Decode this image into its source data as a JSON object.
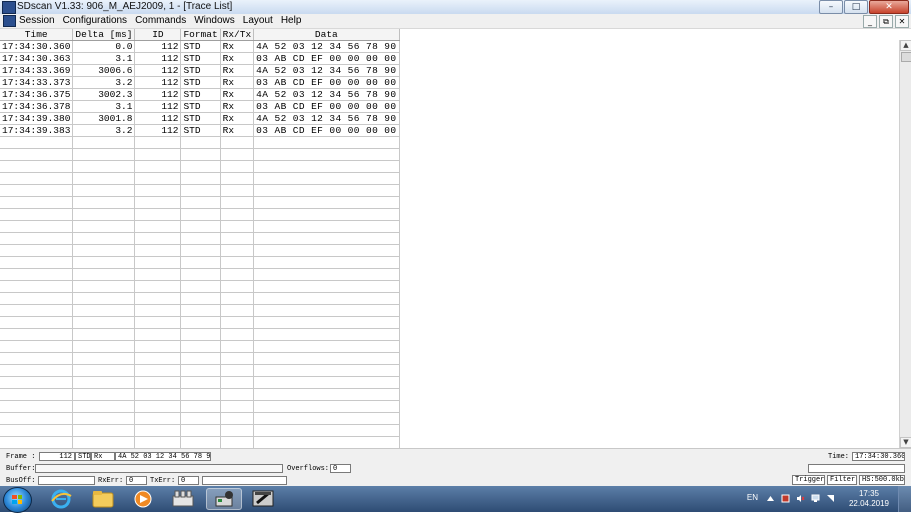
{
  "window": {
    "title": "SDscan V1.33: 906_M_AEJ2009, 1 - [Trace List]",
    "minimize": "–",
    "maximize": "□",
    "close": "✕"
  },
  "menu": {
    "items": [
      "Session",
      "Configurations",
      "Commands",
      "Windows",
      "Layout",
      "Help"
    ],
    "mdi_minimize": "_",
    "mdi_restore": "⧉",
    "mdi_close": "✕"
  },
  "trace": {
    "columns": [
      "Time",
      "Delta [ms]",
      "ID",
      "Format",
      "Rx/Tx",
      "Data"
    ],
    "rows": [
      [
        "17:34:30.360",
        "0.0",
        "112",
        "STD",
        "Rx",
        "4A 52 03 12 34 56 78 90"
      ],
      [
        "17:34:30.363",
        "3.1",
        "112",
        "STD",
        "Rx",
        "03 AB CD EF 00 00 00 00"
      ],
      [
        "17:34:33.369",
        "3006.6",
        "112",
        "STD",
        "Rx",
        "4A 52 03 12 34 56 78 90"
      ],
      [
        "17:34:33.373",
        "3.2",
        "112",
        "STD",
        "Rx",
        "03 AB CD EF 00 00 00 00"
      ],
      [
        "17:34:36.375",
        "3002.3",
        "112",
        "STD",
        "Rx",
        "4A 52 03 12 34 56 78 90"
      ],
      [
        "17:34:36.378",
        "3.1",
        "112",
        "STD",
        "Rx",
        "03 AB CD EF 00 00 00 00"
      ],
      [
        "17:34:39.380",
        "3001.8",
        "112",
        "STD",
        "Rx",
        "4A 52 03 12 34 56 78 90"
      ],
      [
        "17:34:39.383",
        "3.2",
        "112",
        "STD",
        "Rx",
        "03 AB CD EF 00 00 00 00"
      ]
    ]
  },
  "scrollbar": {
    "up": "▲",
    "down": "▼"
  },
  "status": {
    "frame_label": "Frame :",
    "frame_id": "112",
    "frame_format": "STD",
    "frame_dir": "Rx",
    "frame_data": "4A 52 03 12 34 56 78 90",
    "time_label": "Time:",
    "time_value": "17:34:30.360",
    "buffer_label": "Buffer:",
    "overflows_label": "Overflows:",
    "overflows_value": "0",
    "busoff_label": "BusOff:",
    "rxerr_label": "RxErr:",
    "rxerr_value": "0",
    "txerr_label": "TxErr:",
    "txerr_value": "0",
    "trigger_btn": "Trigger",
    "filter_btn": "Filter",
    "speed_btn": "HS:500.0kb"
  },
  "taskbar": {
    "lang": "EN",
    "time": "17:35",
    "date": "22.04.2019",
    "pinned": [
      "internet-explorer",
      "file-explorer",
      "media-player",
      "network-tool",
      "sdscan-app",
      "diagnostic-app"
    ]
  },
  "colors": {
    "accent": "#2b4f8e",
    "taskbar": "#2e4c74",
    "grid_line": "#c8c8c8"
  }
}
